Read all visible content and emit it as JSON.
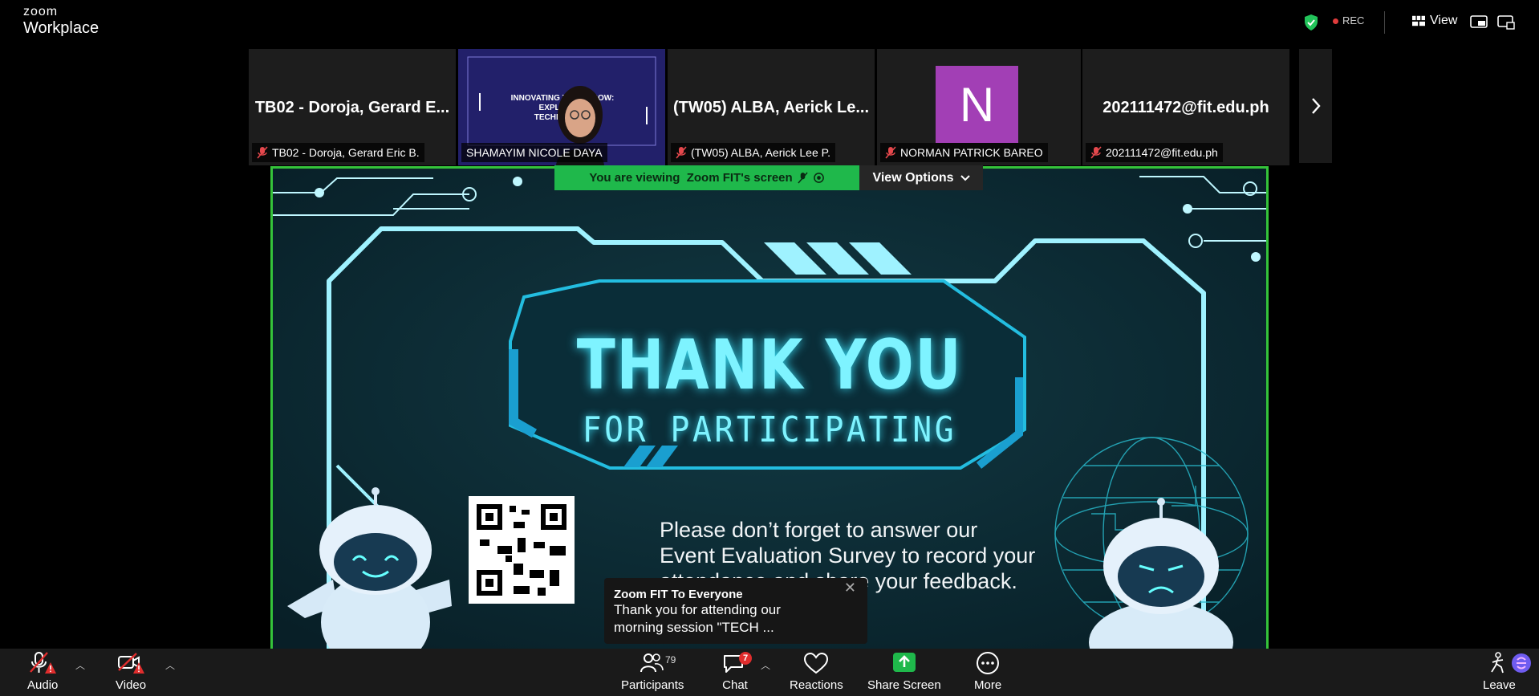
{
  "app": {
    "brand_top": "zoom",
    "brand_bottom": "Workplace"
  },
  "header": {
    "rec_label": "REC",
    "view_label": "View"
  },
  "participants_strip": [
    {
      "big_name": "TB02 - Doroja, Gerard E...",
      "name": "TB02 - Doroja, Gerard Eric B.",
      "muted": true
    },
    {
      "big_name": "",
      "name": "SHAMAYIM NICOLE DAYA",
      "muted": false,
      "video_text": "INNOVATING TOMORROW: EXPLORING TECHNOLOGY"
    },
    {
      "big_name": "(TW05) ALBA, Aerick Le...",
      "name": "(TW05) ALBA, Aerick Lee P.",
      "muted": true
    },
    {
      "big_name": "",
      "name": "NORMAN PATRICK BAREO",
      "muted": true,
      "avatar_letter": "N",
      "avatar_color": "#a23fb5"
    },
    {
      "big_name": "202111472@fit.edu.ph",
      "name": "202111472@fit.edu.ph",
      "muted": true
    }
  ],
  "share_banner": {
    "text": "You are viewing  Zoom FIT's screen",
    "options_label": "View Options"
  },
  "slide": {
    "title": "THANK YOU",
    "subtitle": "FOR PARTICIPATING",
    "survey_line1": "Please don’t forget to answer our",
    "survey_line2": "Event Evaluation Survey to record your",
    "survey_line3": "attendance and share your feedback."
  },
  "chat_popup": {
    "from": "Zoom FIT To Everyone",
    "message": "Thank you for attending our morning session \"TECH ..."
  },
  "toolbar": {
    "audio": "Audio",
    "video": "Video",
    "participants": "Participants",
    "participants_count": "79",
    "chat": "Chat",
    "chat_badge": "7",
    "reactions": "Reactions",
    "share_screen": "Share Screen",
    "more": "More",
    "leave": "Leave"
  },
  "colors": {
    "accent_green": "#35c33a",
    "banner_green": "#1fb84b",
    "alert_red": "#e02d2d",
    "slide_cyan": "#7ef3ff"
  }
}
